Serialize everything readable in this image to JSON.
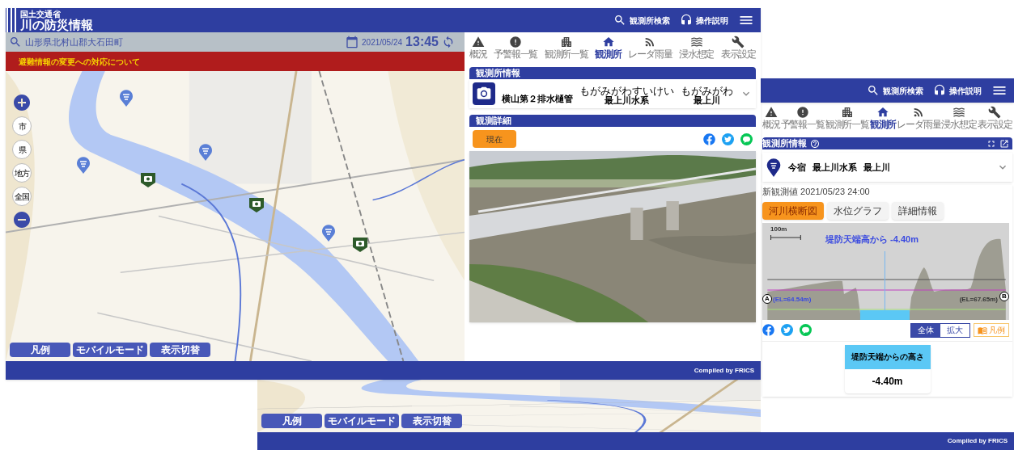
{
  "back_window": {
    "buttons": [
      "凡例",
      "モバイルモード",
      "表示切替"
    ],
    "footer": "Compiled by FRICS"
  },
  "second_window": {
    "header": {
      "actions": [
        {
          "label": "観測所検索",
          "kind": "search"
        },
        {
          "label": "操作説明",
          "kind": "help"
        }
      ]
    },
    "nav": [
      {
        "label": "概況",
        "kind": "overview",
        "selected": false
      },
      {
        "label": "予警報一覧",
        "kind": "warnings",
        "selected": false
      },
      {
        "label": "観測所一覧",
        "kind": "stations",
        "selected": false
      },
      {
        "label": "観測所",
        "kind": "station",
        "selected": true
      },
      {
        "label": "レーダ雨量",
        "kind": "radar",
        "selected": false
      },
      {
        "label": "浸水想定",
        "kind": "flood",
        "selected": false
      },
      {
        "label": "表示設定",
        "kind": "settings",
        "selected": false
      }
    ],
    "station_section": "観測所情報",
    "station": {
      "kind": "gauge",
      "name": "今宿",
      "system": "最上川水系",
      "river": "最上川"
    },
    "latest": "新観測値 2021/05/23 24:00",
    "tabs": [
      {
        "label": "河川横断図",
        "selected": true
      },
      {
        "label": "水位グラフ",
        "selected": false
      },
      {
        "label": "詳細情報",
        "selected": false
      }
    ],
    "cross_section": {
      "scale": "100m",
      "water_label": "堤防天端高から -4.40m",
      "left_marker": "A",
      "left_elevation": "(EL=64.54m)",
      "right_marker": "B",
      "right_elevation": "(EL=67.65m)"
    },
    "view_toggle": [
      {
        "label": "全体",
        "selected": true
      },
      {
        "label": "拡大",
        "selected": false
      }
    ],
    "legend_button": "凡例",
    "height_card": {
      "title": "堤防天端からの高さ",
      "value": "-4.40m"
    }
  },
  "main_window": {
    "header": {
      "ministry": "国土交通省",
      "title": "川の防災情報",
      "actions": [
        {
          "label": "観測所検索",
          "kind": "search"
        },
        {
          "label": "操作説明",
          "kind": "help"
        }
      ]
    },
    "search_bar": {
      "location": "山形県北村山郡大石田町",
      "date": "2021/05/24",
      "time": "13:45"
    },
    "notice": "避難情報の変更への対応について",
    "map_scale_buttons": [
      "市",
      "県",
      "地方",
      "全国"
    ],
    "map_buttons": [
      "凡例",
      "モバイルモード",
      "表示切替"
    ],
    "nav": [
      {
        "label": "概況",
        "kind": "overview",
        "selected": false
      },
      {
        "label": "予警報一覧",
        "kind": "warnings",
        "selected": false
      },
      {
        "label": "観測所一覧",
        "kind": "stations",
        "selected": false
      },
      {
        "label": "観測所",
        "kind": "station",
        "selected": true
      },
      {
        "label": "レーダ雨量",
        "kind": "radar",
        "selected": false
      },
      {
        "label": "浸水想定",
        "kind": "flood",
        "selected": false
      },
      {
        "label": "表示設定",
        "kind": "settings",
        "selected": false
      }
    ],
    "station_section": "観測所情報",
    "station": {
      "kind": "camera",
      "name": "横山第２排水樋管",
      "system": "最上川水系",
      "system_reading": "もがみがわすいけい",
      "river": "最上川",
      "river_reading": "もがみがわ"
    },
    "detail_section": "観測詳細",
    "current_button": "現在",
    "footer": "Compiled by FRICS"
  }
}
